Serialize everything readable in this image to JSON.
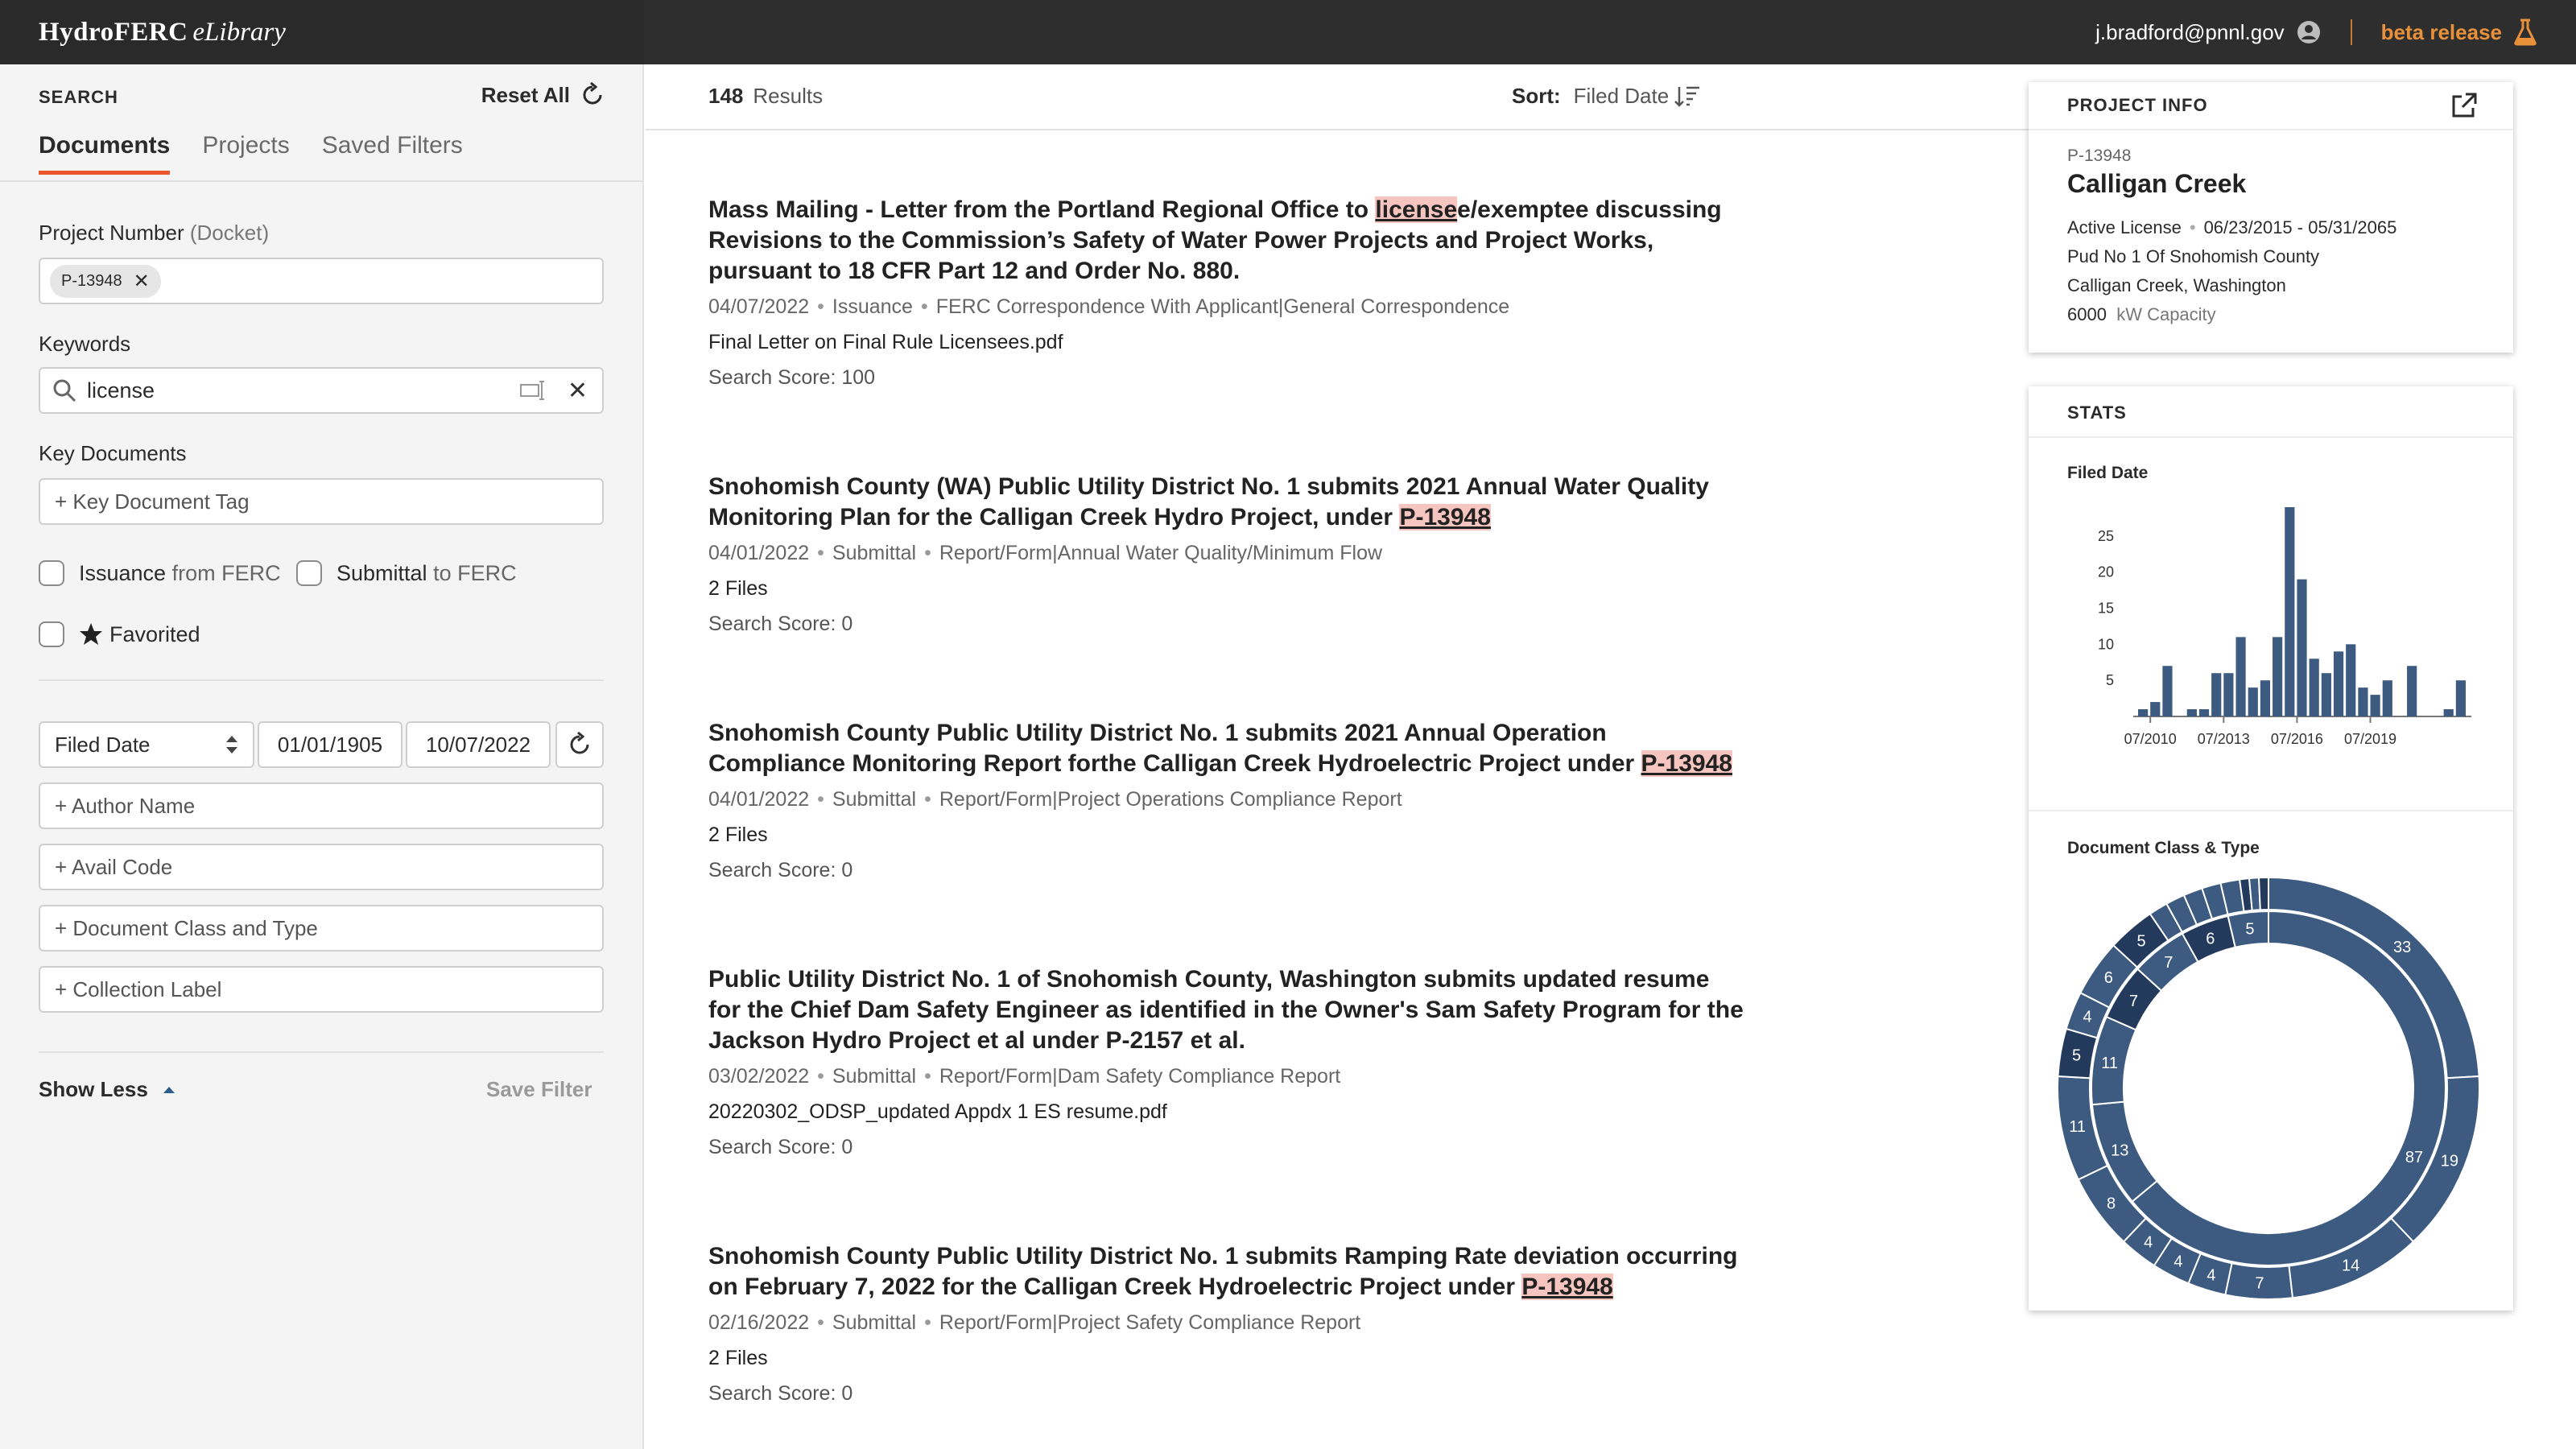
{
  "header": {
    "brand_name": "HydroFERC",
    "brand_sub": "eLibrary",
    "user_email": "j.bradford@pnnl.gov",
    "beta_label": "beta release"
  },
  "sidebar": {
    "search_heading": "SEARCH",
    "reset_label": "Reset All",
    "tabs": [
      {
        "label": "Documents",
        "active": true
      },
      {
        "label": "Projects",
        "active": false
      },
      {
        "label": "Saved Filters",
        "active": false
      }
    ],
    "project_number_label": "Project Number",
    "project_number_hint": "(Docket)",
    "project_chip": "P-13948",
    "keywords_label": "Keywords",
    "keywords_value": "license",
    "key_documents_label": "Key Documents",
    "key_document_placeholder": "+ Key Document Tag",
    "issuance_label": "Issuance",
    "issuance_hint": "from FERC",
    "submittal_label": "Submittal",
    "submittal_hint": "to FERC",
    "favorited_label": "Favorited",
    "date_field_select": "Filed Date",
    "date_from": "01/01/1905",
    "date_to": "10/07/2022",
    "author_placeholder": "+ Author Name",
    "avail_code_placeholder": "+ Avail Code",
    "doc_class_placeholder": "+ Document Class and Type",
    "collection_placeholder": "+ Collection Label",
    "show_less_label": "Show Less",
    "save_filter_label": "Save Filter"
  },
  "results_header": {
    "count": "148",
    "count_label": "Results",
    "sort_label": "Sort:",
    "sort_value": "Filed Date"
  },
  "results": [
    {
      "title_parts": [
        "Mass Mailing - Letter from the Portland Regional Office to ",
        "license",
        "e/exemptee discussing Revisions to the Commission’s Safety of Water Power Projects and Project Works, pursuant to 18 CFR Part 12 and Order No. 880."
      ],
      "date": "04/07/2022",
      "category": "Issuance",
      "type": "FERC Correspondence With Applicant|General Correspondence",
      "line2": "Final Letter on Final Rule Licensees.pdf",
      "score": "Search Score: 100"
    },
    {
      "title_parts": [
        "Snohomish County (WA) Public Utility District No. 1 submits 2021 Annual Water Quality Monitoring Plan for the Calligan Creek Hydro Project, under ",
        "P-13948",
        ""
      ],
      "date": "04/01/2022",
      "category": "Submittal",
      "type": "Report/Form|Annual Water Quality/Minimum Flow",
      "line2": "2 Files",
      "score": "Search Score: 0"
    },
    {
      "title_parts": [
        "Snohomish County Public Utility District No. 1 submits 2021 Annual Operation Compliance Monitoring Report forthe Calligan Creek Hydroelectric Project under ",
        "P-13948",
        ""
      ],
      "date": "04/01/2022",
      "category": "Submittal",
      "type": "Report/Form|Project Operations Compliance Report",
      "line2": "2 Files",
      "score": "Search Score: 0"
    },
    {
      "title_parts": [
        "Public Utility District No. 1 of Snohomish County, Washington submits updated resume for the Chief Dam Safety Engineer as identified in the Owner's Sam Safety Program for the Jackson Hydro Project et al under P-2157 et al.",
        "",
        ""
      ],
      "date": "03/02/2022",
      "category": "Submittal",
      "type": "Report/Form|Dam Safety Compliance Report",
      "line2": "20220302_ODSP_updated Appdx 1 ES resume.pdf",
      "score": "Search Score: 0"
    },
    {
      "title_parts": [
        "Snohomish County Public Utility District No. 1 submits Ramping Rate deviation occurring on February 7, 2022 for the Calligan Creek Hydroelectric Project under ",
        "P-13948",
        ""
      ],
      "date": "02/16/2022",
      "category": "Submittal",
      "type": "Report/Form|Project Safety Compliance Report",
      "line2": "2 Files",
      "score": "Search Score: 0"
    }
  ],
  "project_info": {
    "heading": "PROJECT INFO",
    "number": "P-13948",
    "name": "Calligan Creek",
    "license_status": "Active License",
    "license_dates": "06/23/2015 - 05/31/2065",
    "owner": "Pud No 1 Of Snohomish County",
    "location": "Calligan Creek, Washington",
    "capacity_value": "6000",
    "capacity_unit": "kW Capacity"
  },
  "stats": {
    "heading": "STATS",
    "filed_date_title": "Filed Date",
    "doc_class_title": "Document Class & Type"
  },
  "chart_data": [
    {
      "type": "bar",
      "title": "Filed Date",
      "xlabel": "",
      "ylabel": "",
      "ylim": [
        0,
        29
      ],
      "y_ticks": [
        5,
        10,
        15,
        20,
        25
      ],
      "x_tick_labels": [
        "07/2010",
        "07/2013",
        "07/2016",
        "07/2019"
      ],
      "values": [
        1,
        2,
        7,
        0,
        1,
        1,
        6,
        6,
        11,
        4,
        5,
        11,
        29,
        19,
        8,
        6,
        9,
        10,
        4,
        3,
        5,
        0,
        7,
        0,
        0,
        1,
        5
      ],
      "color": "#3d5a80"
    },
    {
      "type": "pie",
      "title": "Document Class & Type",
      "inner_ring": {
        "labels": [
          "87",
          "13",
          "11",
          "7",
          "7",
          "6",
          "5"
        ],
        "values": [
          87,
          13,
          11,
          7,
          7,
          6,
          5
        ],
        "colors": [
          "#3d5a80",
          "#3d5a80",
          "#3d5a80",
          "#233a5c",
          "#3d5a80",
          "#233a5c",
          "#3d5a80"
        ]
      },
      "outer_ring": {
        "labels": [
          "33",
          "19",
          "14",
          "7",
          "4",
          "4",
          "4",
          "8",
          "11",
          "5",
          "4",
          "6",
          "5",
          "",
          "",
          "",
          "",
          "",
          "",
          "",
          ""
        ],
        "values": [
          33,
          19,
          14,
          7,
          4,
          4,
          4,
          8,
          11,
          5,
          4,
          6,
          5,
          2,
          2,
          2,
          2,
          2,
          1,
          1,
          1
        ],
        "colors": [
          "#3d5a80",
          "#3d5a80",
          "#3d5a80",
          "#3d5a80",
          "#3d5a80",
          "#3d5a80",
          "#3d5a80",
          "#3d5a80",
          "#3d5a80",
          "#233a5c",
          "#3d5a80",
          "#3d5a80",
          "#233a5c",
          "#3d5a80",
          "#3d5a80",
          "#3d5a80",
          "#3d5a80",
          "#3d5a80",
          "#233a5c",
          "#3d5a80",
          "#233a5c"
        ]
      }
    }
  ]
}
